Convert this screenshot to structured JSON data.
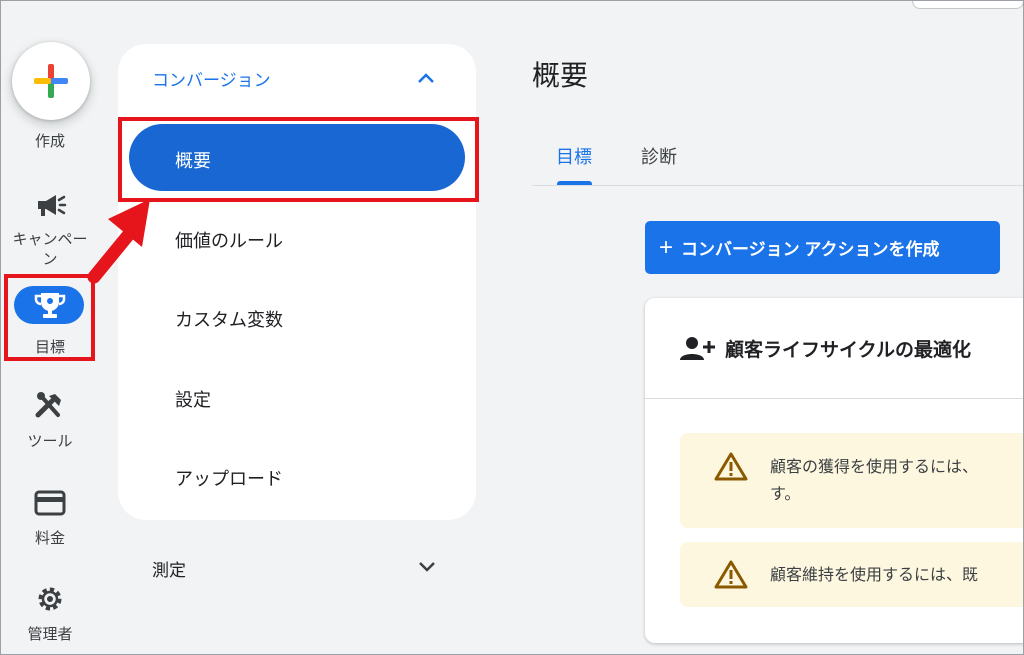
{
  "rail": {
    "create_label": "作成",
    "campaigns_label_line1": "キャンペー",
    "campaigns_label_line2": "ン",
    "goals_label": "目標",
    "tools_label": "ツール",
    "billing_label": "料金",
    "admin_label": "管理者"
  },
  "subnav": {
    "section_title": "コンバージョン",
    "items": [
      "概要",
      "価値のルール",
      "カスタム変数",
      "設定",
      "アップロード"
    ],
    "measure_label": "測定"
  },
  "main": {
    "title": "概要",
    "tabs": [
      "目標",
      "診断"
    ],
    "create_action_button": "コンバージョン アクションを作成",
    "card_title": "顧客ライフサイクルの最適化",
    "warnings": [
      {
        "line1": "顧客の獲得を使用するには、",
        "line2": "す。"
      },
      {
        "line1": "顧客維持を使用するには、既"
      }
    ]
  },
  "colors": {
    "accent": "#1a73e8",
    "active_nav": "#1967d2",
    "annotation_red": "#e6141b",
    "warning_bg": "#fef7e0",
    "warning_icon": "#8a5a00"
  },
  "icons": [
    "plus-icon",
    "megaphone-icon",
    "trophy-icon",
    "tools-icon",
    "credit-card-icon",
    "gear-icon",
    "chevron-up-icon",
    "chevron-down-icon",
    "person-add-icon",
    "warning-icon"
  ]
}
